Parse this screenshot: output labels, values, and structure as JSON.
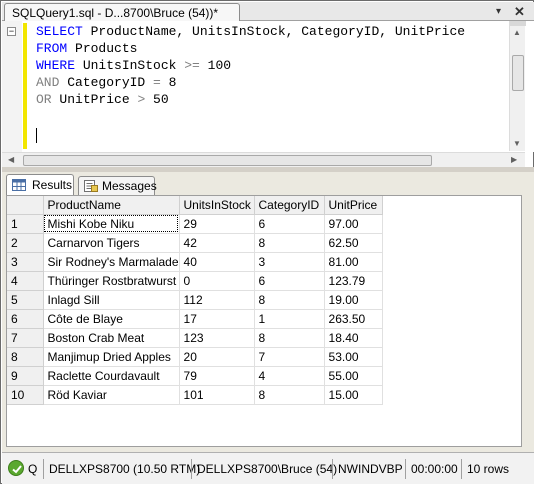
{
  "window": {
    "tab_title": "SQLQuery1.sql - D...8700\\Bruce (54))*",
    "pin_glyph": "▾",
    "close_glyph": "✕"
  },
  "editor": {
    "collapse_glyph": "−",
    "lines": [
      [
        {
          "t": "SELECT",
          "c": "kw"
        },
        {
          "t": " ProductName, UnitsInStock, CategoryID, UnitPrice",
          "c": "tx"
        }
      ],
      [
        {
          "t": "FROM",
          "c": "kw"
        },
        {
          "t": " Products",
          "c": "tx"
        }
      ],
      [
        {
          "t": "WHERE",
          "c": "kw"
        },
        {
          "t": " UnitsInStock ",
          "c": "tx"
        },
        {
          "t": ">=",
          "c": "op"
        },
        {
          "t": " 100",
          "c": "tx"
        }
      ],
      [
        {
          "t": "AND",
          "c": "op"
        },
        {
          "t": " CategoryID ",
          "c": "tx"
        },
        {
          "t": "=",
          "c": "op"
        },
        {
          "t": " 8",
          "c": "tx"
        }
      ],
      [
        {
          "t": "OR",
          "c": "op"
        },
        {
          "t": " UnitPrice ",
          "c": "tx"
        },
        {
          "t": ">",
          "c": "op"
        },
        {
          "t": " 50",
          "c": "tx"
        }
      ]
    ]
  },
  "results_tabs": {
    "results_label": "Results",
    "messages_label": "Messages"
  },
  "grid": {
    "columns": [
      "",
      "ProductName",
      "UnitsInStock",
      "CategoryID",
      "UnitPrice"
    ],
    "rows": [
      [
        "1",
        "Mishi Kobe Niku",
        "29",
        "6",
        "97.00"
      ],
      [
        "2",
        "Carnarvon Tigers",
        "42",
        "8",
        "62.50"
      ],
      [
        "3",
        "Sir Rodney's Marmalade",
        "40",
        "3",
        "81.00"
      ],
      [
        "4",
        "Thüringer Rostbratwurst",
        "0",
        "6",
        "123.79"
      ],
      [
        "5",
        "Inlagd Sill",
        "112",
        "8",
        "19.00"
      ],
      [
        "6",
        "Côte de Blaye",
        "17",
        "1",
        "263.50"
      ],
      [
        "7",
        "Boston Crab Meat",
        "123",
        "8",
        "18.40"
      ],
      [
        "8",
        "Manjimup Dried Apples",
        "20",
        "7",
        "53.00"
      ],
      [
        "9",
        "Raclette Courdavault",
        "79",
        "4",
        "55.00"
      ],
      [
        "10",
        "Röd Kaviar",
        "101",
        "8",
        "15.00"
      ]
    ]
  },
  "status": {
    "state": "Q",
    "server": "DELLXPS8700 (10.50 RTM)",
    "user": "DELLXPS8700\\Bruce (54)",
    "database": "NWINDVBP",
    "elapsed": "00:00:00",
    "row_count": "10 rows"
  },
  "colors": {
    "keyword": "#0000ff",
    "operator": "#808080",
    "change_bar": "#f2e600",
    "status_ok": "#5aa82e"
  }
}
